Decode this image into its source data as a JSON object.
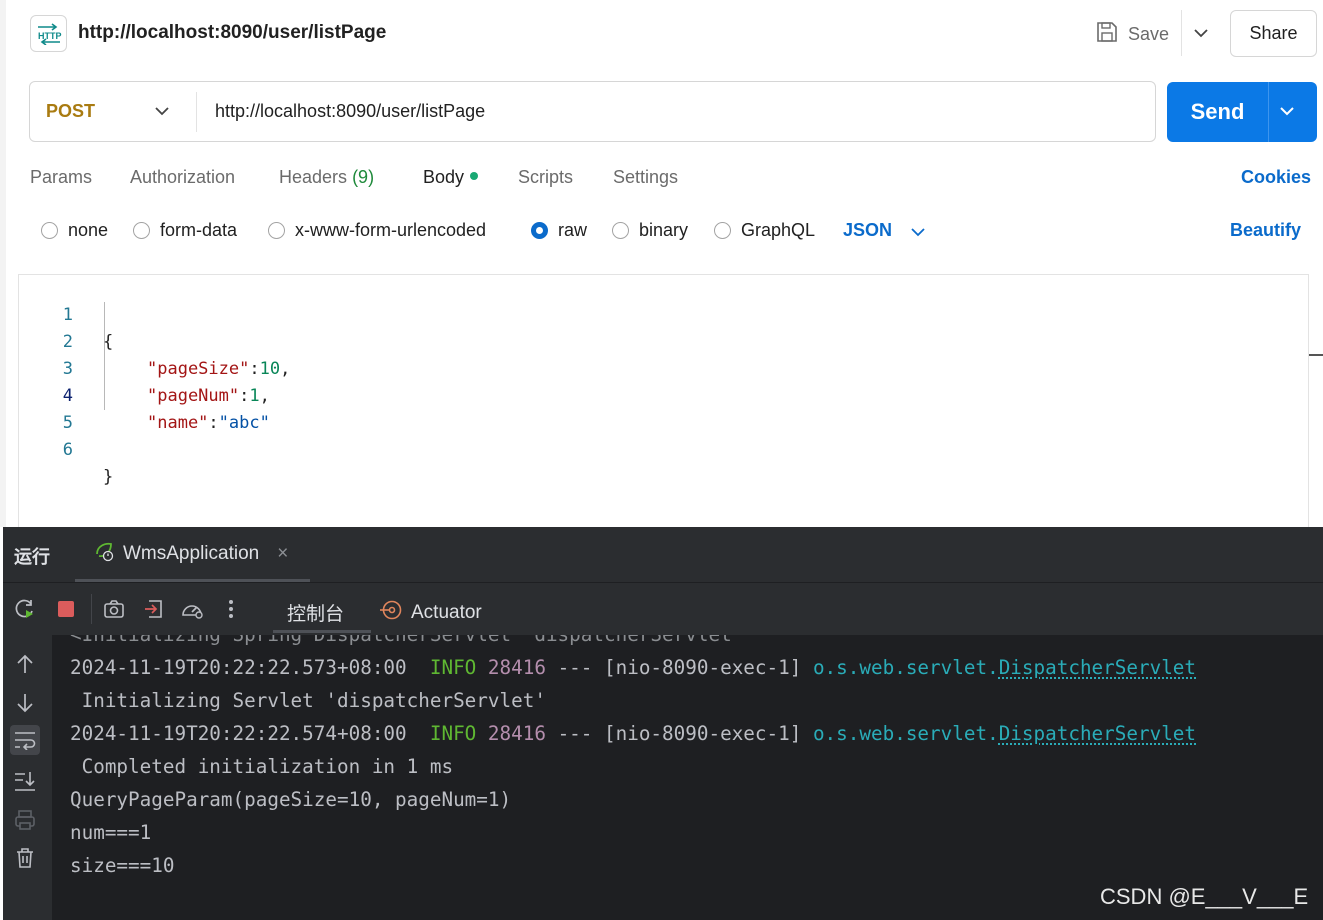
{
  "header": {
    "title": "http://localhost:8090/user/listPage",
    "save_label": "Save",
    "share_label": "Share",
    "http_icon_text": "HTTP"
  },
  "request": {
    "method": "POST",
    "url": "http://localhost:8090/user/listPage",
    "send_label": "Send"
  },
  "tabs": {
    "params": "Params",
    "authorization": "Authorization",
    "headers": "Headers",
    "headers_count": "(9)",
    "body": "Body",
    "scripts": "Scripts",
    "settings": "Settings",
    "cookies": "Cookies"
  },
  "body_types": {
    "none": "none",
    "form_data": "form-data",
    "urlencoded": "x-www-form-urlencoded",
    "raw": "raw",
    "binary": "binary",
    "graphql": "GraphQL",
    "selected": "raw",
    "format": "JSON",
    "beautify": "Beautify"
  },
  "editor": {
    "line_numbers": [
      "1",
      "2",
      "3",
      "4",
      "5",
      "6"
    ],
    "current_line": "4",
    "open_brace": "{",
    "close_brace": "}",
    "fields": [
      {
        "key": "\"pageSize\"",
        "colon": ":",
        "value": "10",
        "suffix": ","
      },
      {
        "key": "\"pageNum\"",
        "colon": ":",
        "value": "1",
        "suffix": ","
      },
      {
        "key": "\"name\"",
        "colon": ":",
        "value": "\"abc\"",
        "suffix": ""
      }
    ]
  },
  "run_panel": {
    "title": "运行",
    "tab_label": "WmsApplication",
    "close_symbol": "×",
    "console_tab": "控制台",
    "actuator_tab": "Actuator"
  },
  "console": {
    "partial_line": "<Initializing Spring DispatcherServlet 'dispatcherServlet'",
    "log_lines": [
      {
        "timestamp": "2024-11-19T20:22:22.573+08:00",
        "level": "INFO",
        "pid": "28416",
        "sep": "---",
        "thread": "[nio-8090-exec-1]",
        "logger_prefix": "o.s.web.servlet.",
        "logger_class": "DispatcherServlet",
        "message": " Initializing Servlet 'dispatcherServlet'"
      },
      {
        "timestamp": "2024-11-19T20:22:22.574+08:00",
        "level": "INFO",
        "pid": "28416",
        "sep": "---",
        "thread": "[nio-8090-exec-1]",
        "logger_prefix": "o.s.web.servlet.",
        "logger_class": "DispatcherServlet",
        "message": " Completed initialization in 1 ms"
      }
    ],
    "plain_lines": [
      "QueryPageParam(pageSize=10, pageNum=1)",
      "num===1",
      "size===10"
    ]
  },
  "watermark": "CSDN @E___V___E",
  "colors": {
    "send": "#0b79e6",
    "accent_link": "#0b6bcb",
    "method": "#a97b11",
    "ide_bg": "#2b2d30",
    "console_bg": "#1e1f22"
  },
  "icons": {
    "http": "http-icon",
    "save": "floppy-disk-icon",
    "rerun": "rerun-icon",
    "stop": "stop-icon",
    "camera": "camera-icon",
    "exit": "exit-icon",
    "gauge": "gauge-icon",
    "more": "more-vertical-icon",
    "actuator": "actuator-icon",
    "up": "arrow-up-icon",
    "down": "arrow-down-icon",
    "wrap": "soft-wrap-icon",
    "scroll_end": "scroll-to-end-icon",
    "print": "print-icon",
    "trash": "trash-icon"
  }
}
